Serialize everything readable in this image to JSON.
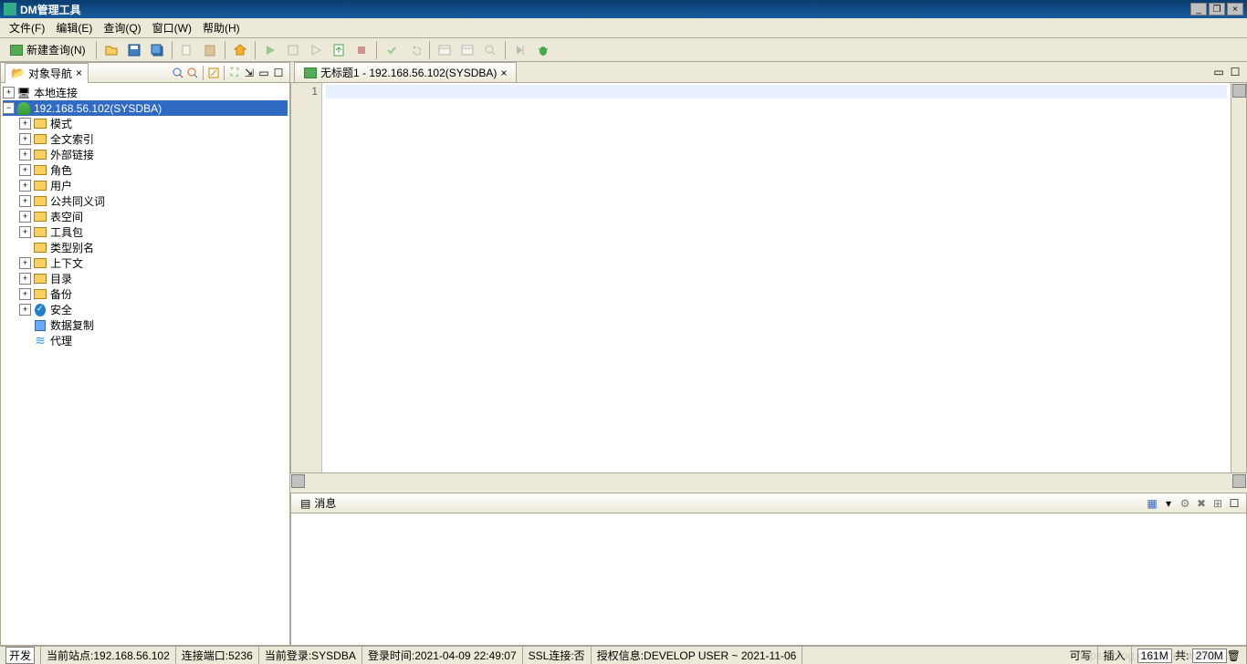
{
  "app": {
    "title": "DM管理工具"
  },
  "menu": {
    "file": "文件(F)",
    "edit": "编辑(E)",
    "query": "查询(Q)",
    "window": "窗口(W)",
    "help": "帮助(H)"
  },
  "toolbar": {
    "newquery": "新建查询(N)"
  },
  "nav": {
    "title": "对象导航",
    "local": "本地连接",
    "conn": "192.168.56.102(SYSDBA)",
    "items": [
      "模式",
      "全文索引",
      "外部链接",
      "角色",
      "用户",
      "公共同义词",
      "表空间",
      "工具包",
      "类型别名",
      "上下文",
      "目录",
      "备份",
      "安全",
      "数据复制",
      "代理"
    ]
  },
  "editor": {
    "tab": "无标题1 - 192.168.56.102(SYSDBA)",
    "line1": "1"
  },
  "msg": {
    "title": "消息"
  },
  "status": {
    "dev": "开发",
    "site_label": "当前站点:",
    "site": "192.168.56.102",
    "port_label": "连接端口:",
    "port": "5236",
    "login_label": "当前登录:",
    "login": "SYSDBA",
    "time_label": "登录时间:",
    "time": "2021-04-09 22:49:07",
    "ssl_label": "SSL连接:",
    "ssl": "否",
    "auth_label": "授权信息:",
    "auth": "DEVELOP USER ~ 2021-11-06",
    "rw": "可写",
    "ins": "插入",
    "mem1": "161M",
    "memsep": "共:",
    "mem2": "270M"
  },
  "watermark": "https://blog.csdn.net/weixin..."
}
